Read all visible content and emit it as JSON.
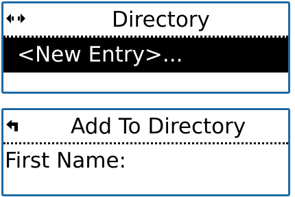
{
  "directory_screen": {
    "nav_icon": "left-right-arrows-icon",
    "title": "Directory",
    "selected_item": "<New Entry>..."
  },
  "add_screen": {
    "nav_icon": "back-arrow-icon",
    "title": "Add To Directory",
    "field_label": "First Name:"
  },
  "colors": {
    "bezel": "#1d6aa5",
    "highlight_bg": "#000000",
    "highlight_text": "#ffffff"
  }
}
